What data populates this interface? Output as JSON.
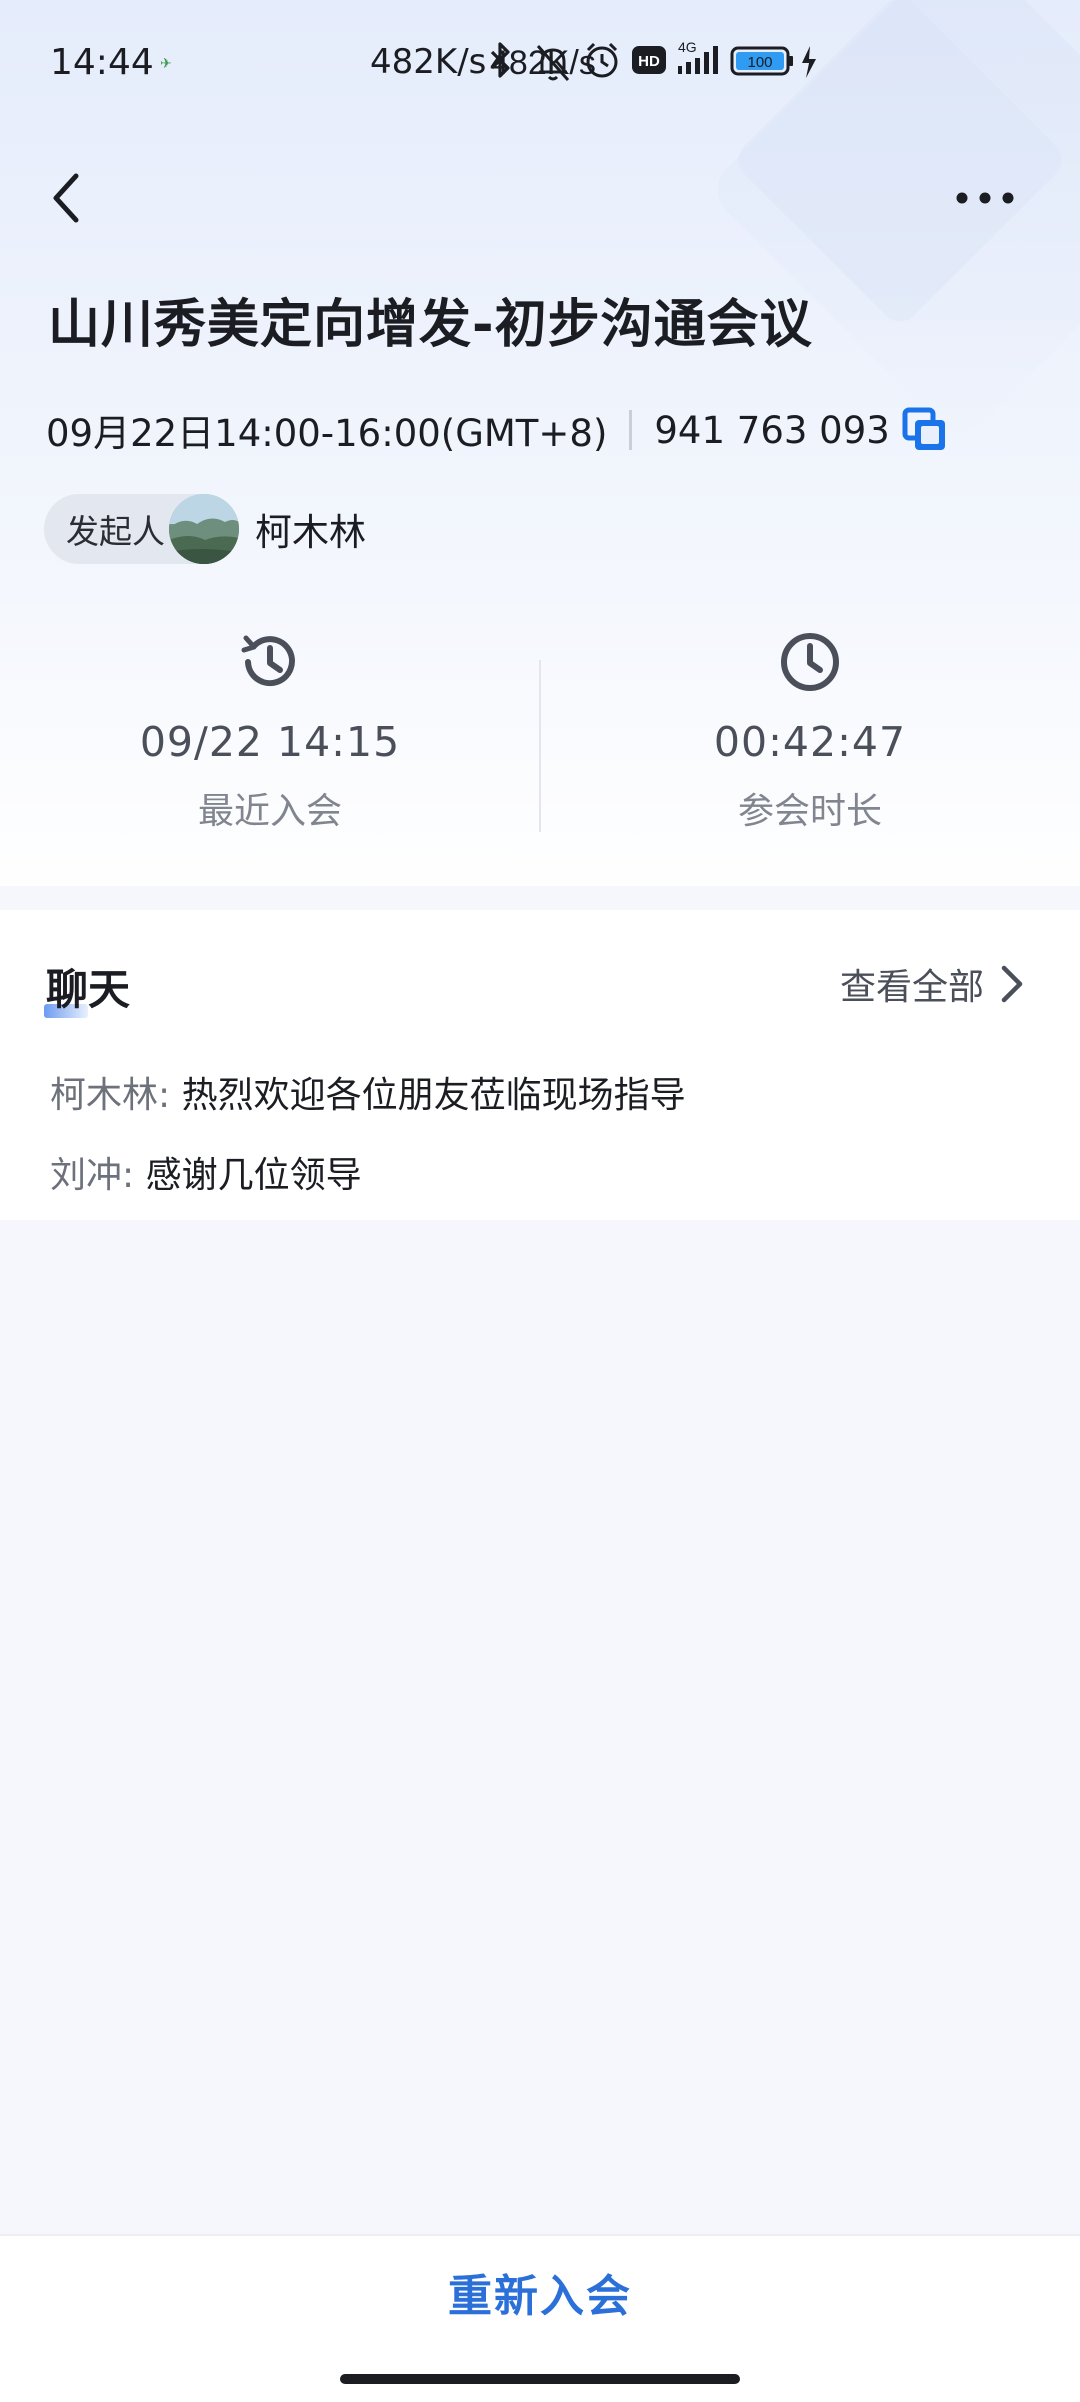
{
  "status_bar": {
    "time": "14:44",
    "network_speed": "482K/s",
    "network_type": "4G",
    "battery": "100"
  },
  "meeting": {
    "title": "山川秀美定向增发-初步沟通会议",
    "schedule": "09月22日14:00-16:00(GMT+8)",
    "meeting_id": "941 763 093"
  },
  "initiator": {
    "label": "发起人",
    "name": "柯木林"
  },
  "stats": {
    "last_join_value": "09/22 14:15",
    "last_join_label": "最近入会",
    "duration_value": "00:42:47",
    "duration_label": "参会时长"
  },
  "chat": {
    "title": "聊天",
    "view_all": "查看全部",
    "messages": [
      {
        "sender": "柯木林:",
        "text": "热烈欢迎各位朋友莅临现场指导"
      },
      {
        "sender": "刘冲:",
        "text": "感谢几位领导"
      }
    ]
  },
  "footer": {
    "rejoin": "重新入会"
  },
  "colors": {
    "accent": "#2b6fd9",
    "copy_icon": "#1a73e8"
  }
}
